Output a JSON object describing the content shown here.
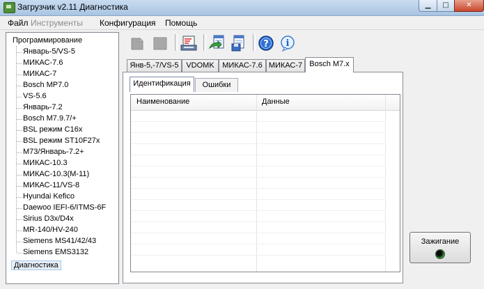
{
  "window": {
    "title": "Загрузчик v2.11 Диагностика"
  },
  "menu": [
    "Файл",
    "Инструменты",
    "Конфигурация",
    "Помощь"
  ],
  "tree": {
    "root": "Программирование",
    "items": [
      "Январь-5/VS-5",
      "МИКАС-7.6",
      "МИКАС-7",
      "Bosch MP7.0",
      "VS-5.6",
      "Январь-7.2",
      "Bosch M7.9.7/+",
      "BSL режим C16x",
      "BSL режим ST10F27x",
      "M73/Январь-7.2+",
      "МИКАС-10.3",
      "МИКАС-10.3(M-11)",
      "МИКАС-11/VS-8",
      "Hyundai Kefico",
      "Daewoo IEFI-6/ITMS-6F",
      "Sirius D3x/D4x",
      "MR-140/HV-240",
      "Siemens MS41/42/43",
      "Siemens EMS3132"
    ],
    "selected": "Диагностика"
  },
  "toolbar": {
    "icons": [
      "read-icon",
      "stop-icon",
      "print-report-icon",
      "export-icon",
      "save-data-icon",
      "help-icon",
      "info-icon"
    ]
  },
  "tabs": [
    "Янв-5,-7/VS-5",
    "VDOMK",
    "МИКАС-7.6",
    "МИКАС-7",
    "Bosch M7.x"
  ],
  "active_tab": "Bosch M7.x",
  "subtabs": [
    "Идентификация",
    "Ошибки"
  ],
  "active_subtab": "Идентификация",
  "grid": {
    "columns": [
      "Наименование",
      "Данные"
    ]
  },
  "ignition": {
    "label": "Зажигание"
  }
}
